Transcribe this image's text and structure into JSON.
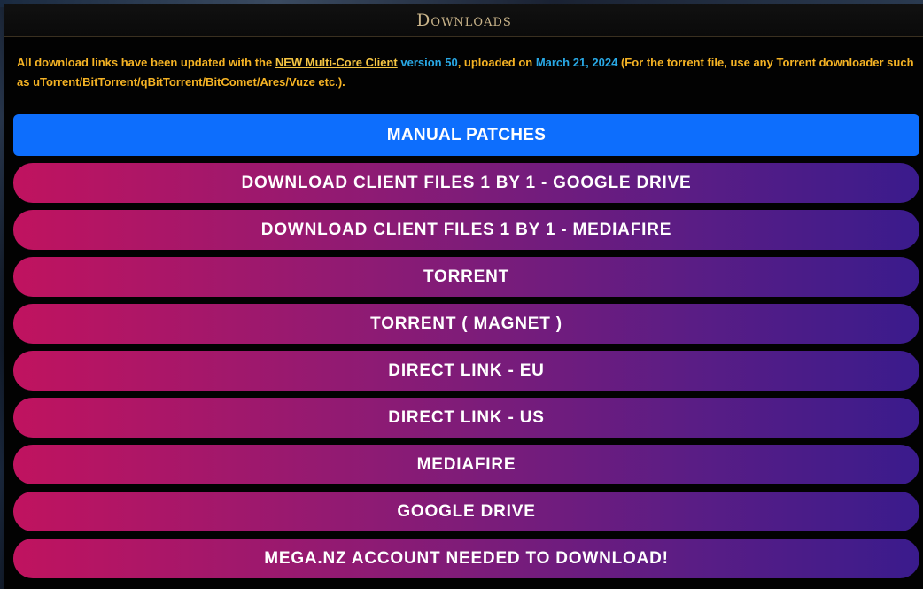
{
  "panel": {
    "title": "Downloads"
  },
  "notice": {
    "part1": "All download links have been updated with the ",
    "client_link": "NEW Multi-Core Client",
    "part2": " ",
    "version": "version 50",
    "part3": ", uploaded on ",
    "date": "March 21, 2024",
    "part4": " (For the torrent file, use any Torrent downloader such as uTorrent/BitTorrent/qBitTorrent/BitComet/Ares/Vuze etc.)."
  },
  "buttons": [
    {
      "label": "MANUAL PATCHES"
    },
    {
      "label": "DOWNLOAD CLIENT FILES 1 BY 1 - GOOGLE DRIVE"
    },
    {
      "label": "DOWNLOAD CLIENT FILES 1 BY 1 - MEDIAFIRE"
    },
    {
      "label": "TORRENT"
    },
    {
      "label": "TORRENT ( MAGNET )"
    },
    {
      "label": "DIRECT LINK - EU"
    },
    {
      "label": "DIRECT LINK - US"
    },
    {
      "label": "MEDIAFIRE"
    },
    {
      "label": "GOOGLE DRIVE"
    },
    {
      "label": "MEGA.NZ ACCOUNT NEEDED TO DOWNLOAD!"
    }
  ],
  "colors": {
    "primary_button": "#0d6efd",
    "gradient_start": "#c0135f",
    "gradient_end": "#3a1b8c",
    "notice_text": "#f5b324",
    "notice_highlight": "#29a9e6"
  }
}
